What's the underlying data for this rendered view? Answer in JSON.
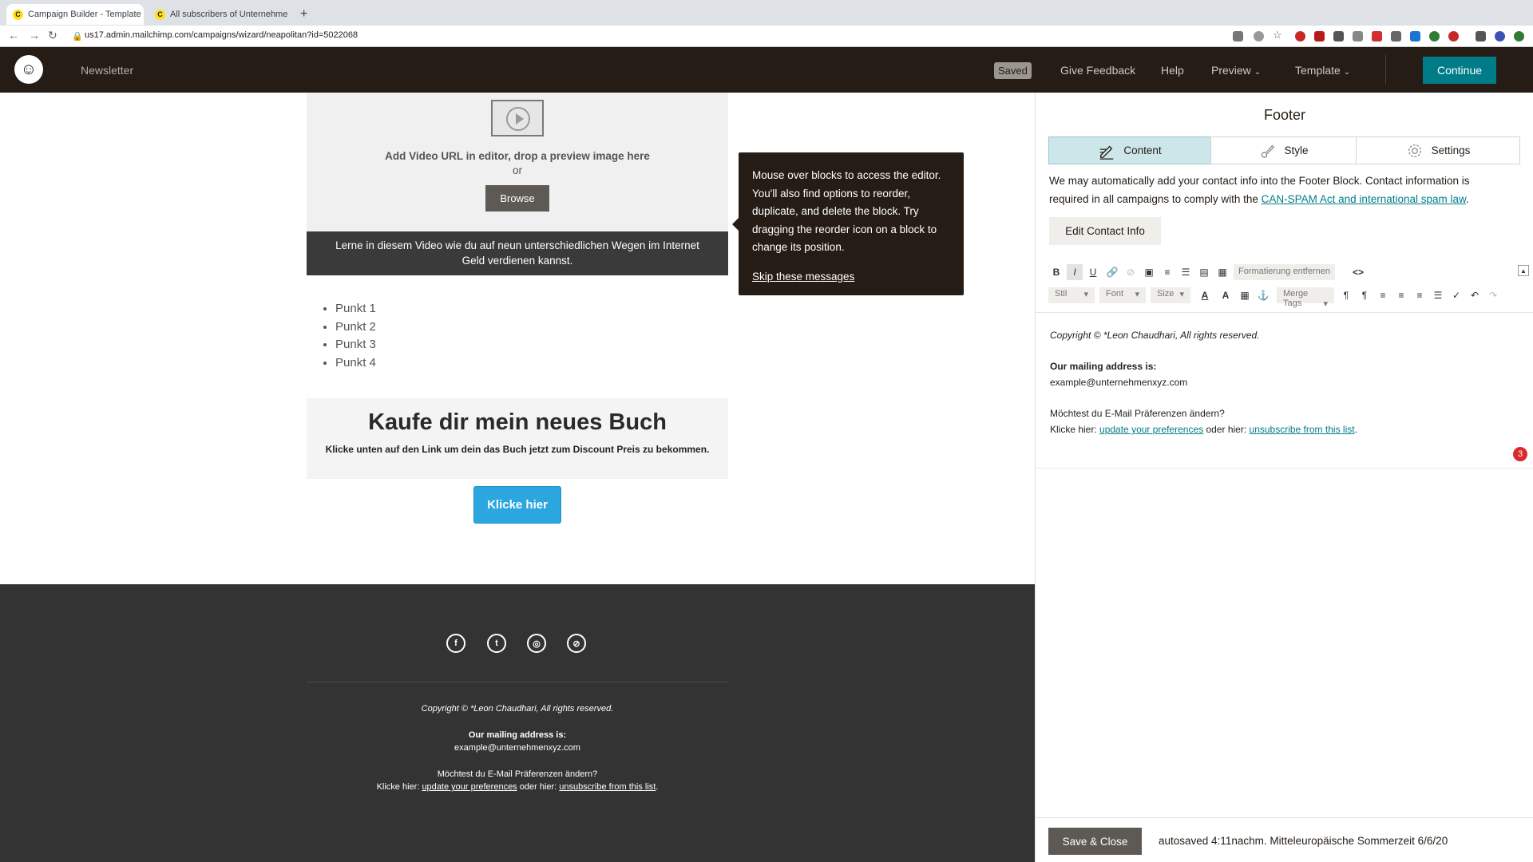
{
  "browser": {
    "tabs": [
      {
        "title": "Campaign Builder - Template D",
        "active": true
      },
      {
        "title": "All subscribers of Unternehme",
        "active": false
      }
    ],
    "new_tab": "+",
    "url": "us17.admin.mailchimp.com/campaigns/wizard/neapolitan?id=5022068"
  },
  "header": {
    "campaign_name": "Newsletter",
    "saved_badge": "Saved",
    "give_feedback": "Give Feedback",
    "help": "Help",
    "preview": "Preview",
    "template": "Template",
    "continue": "Continue"
  },
  "canvas": {
    "video": {
      "prompt": "Add Video URL in editor, drop a preview image here",
      "or": "or",
      "browse": "Browse",
      "caption": "Lerne in diesem Video wie du auf neun unterschiedlichen Wegen im Internet Geld verdienen kannst."
    },
    "bullets": [
      "Punkt 1",
      "Punkt 2",
      "Punkt 3",
      "Punkt 4"
    ],
    "promo": {
      "title": "Kaufe dir mein neues Buch",
      "subtitle": "Klicke unten auf den Link um dein das Buch jetzt zum Discount Preis zu bekommen."
    },
    "cta_button": "Klicke hier",
    "tooltip": {
      "text": "Mouse over blocks to access the editor. You'll also find options to reorder, duplicate, and delete the block. Try dragging the reorder icon on a block to change its position.",
      "skip": "Skip these messages"
    },
    "footer": {
      "copyright": "Copyright © *Leon Chaudhari, All rights reserved.",
      "mailing_label": "Our mailing address is:",
      "email": "example@unternehmenxyz.com",
      "question": "Möchtest du E-Mail Präferenzen ändern?",
      "click_prefix": "Klicke hier:",
      "update_link": "update your preferences",
      "or_text": "oder hier:",
      "unsubscribe_link": "unsubscribe from this list",
      "period": "."
    }
  },
  "panel": {
    "title": "Footer",
    "tabs": {
      "content": "Content",
      "style": "Style",
      "settings": "Settings"
    },
    "description_part1": "We may automatically add your contact info into the Footer Block. Contact information is required in all campaigns to comply with the ",
    "description_link": "CAN-SPAM Act and international spam law",
    "description_end": ".",
    "edit_contact": "Edit Contact Info",
    "toolbar": {
      "bold": "B",
      "italic": "I",
      "underline": "U",
      "format_remove": "Formatierung entfernen",
      "source": "<>",
      "style_dd": "Stil",
      "font_dd": "Font",
      "size_dd": "Size",
      "merge_tags": "Merge Tags"
    },
    "editor": {
      "copyright": "Copyright © *Leon Chaudhari, All rights reserved.",
      "mailing_label": "Our mailing address is:",
      "email": "example@unternehmenxyz.com",
      "question": "Möchtest du E-Mail Präferenzen ändern?",
      "click_prefix": "Klicke hier:",
      "update_link": "update your preferences",
      "or_text": "oder hier:",
      "unsubscribe_link": "unsubscribe from this list",
      "period": "."
    },
    "notification_count": "3",
    "save_close": "Save & Close",
    "autosaved": "autosaved 4:11nachm. Mitteleuropäische Sommerzeit 6/6/20"
  },
  "colors": {
    "header_bg": "#241c15",
    "accent": "#007c89",
    "cta": "#2ba6de",
    "tab_selected": "#cde6ea"
  }
}
